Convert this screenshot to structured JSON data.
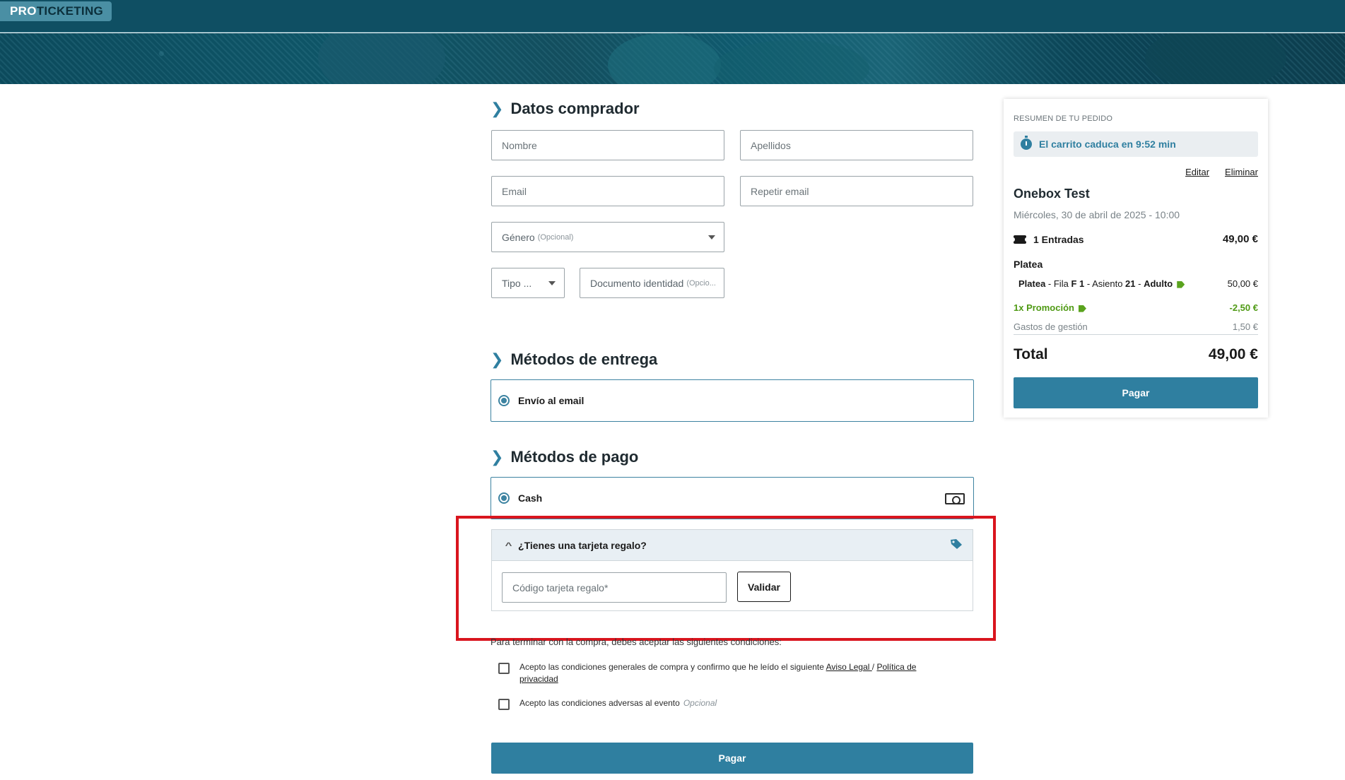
{
  "header": {
    "logo_pro": "PRO",
    "logo_ticketing": "TICKETING"
  },
  "buyer": {
    "title": "Datos comprador",
    "nombre_placeholder": "Nombre",
    "apellidos_placeholder": "Apellidos",
    "email_placeholder": "Email",
    "repeat_email_placeholder": "Repetir email",
    "genero_label": "Género",
    "genero_optional": "(Opcional)",
    "tipo_label": "Tipo ...",
    "documento_label": "Documento identidad",
    "documento_optional": "(Opcio..."
  },
  "delivery": {
    "title": "Métodos de entrega",
    "option": "Envío al email"
  },
  "payment": {
    "title": "Métodos de pago",
    "option": "Cash"
  },
  "gift_card": {
    "title": "¿Tienes una tarjeta regalo?",
    "code_placeholder": "Código tarjeta regalo*",
    "validate_label": "Validar"
  },
  "conditions": {
    "intro": "Para terminar con la compra, debes aceptar las siguientes condiciones:",
    "general_text": "Acepto las condiciones generales de compra y confirmo que he leído el siguiente ",
    "aviso_legal": "Aviso Legal ",
    "separator": "/ ",
    "privacy": "Política de privacidad",
    "adverse_text": "Acepto las condiciones adversas al evento",
    "adverse_optional": "Opcional"
  },
  "pay_button": "Pagar",
  "summary": {
    "label": "RESUMEN DE TU PEDIDO",
    "timer": "El carrito caduca en 9:52 min",
    "edit": "Editar",
    "delete": "Eliminar",
    "event_name": "Onebox Test",
    "event_date": "Miércoles, 30 de abril de 2025 - 10:00",
    "tickets_label": "1 Entradas",
    "tickets_price": "49,00 €",
    "zone": "Platea",
    "seat_zone": "Platea",
    "seat_sep1": " - Fila ",
    "seat_row": "F 1",
    "seat_sep2": " - Asiento ",
    "seat_num": "21",
    "seat_sep3": " - ",
    "seat_type": "Adulto",
    "seat_price": "50,00 €",
    "promo_label": "1x Promoción",
    "promo_price": "-2,50 €",
    "fees_label": "Gastos de gestión",
    "fees_price": "1,50 €",
    "total_label": "Total",
    "total_price": "49,00 €",
    "pay_label": "Pagar"
  },
  "colors": {
    "header": "#0f4f63",
    "accent": "#2f7fa0",
    "highlight": "#d9151e",
    "promo": "#4f9a14"
  }
}
